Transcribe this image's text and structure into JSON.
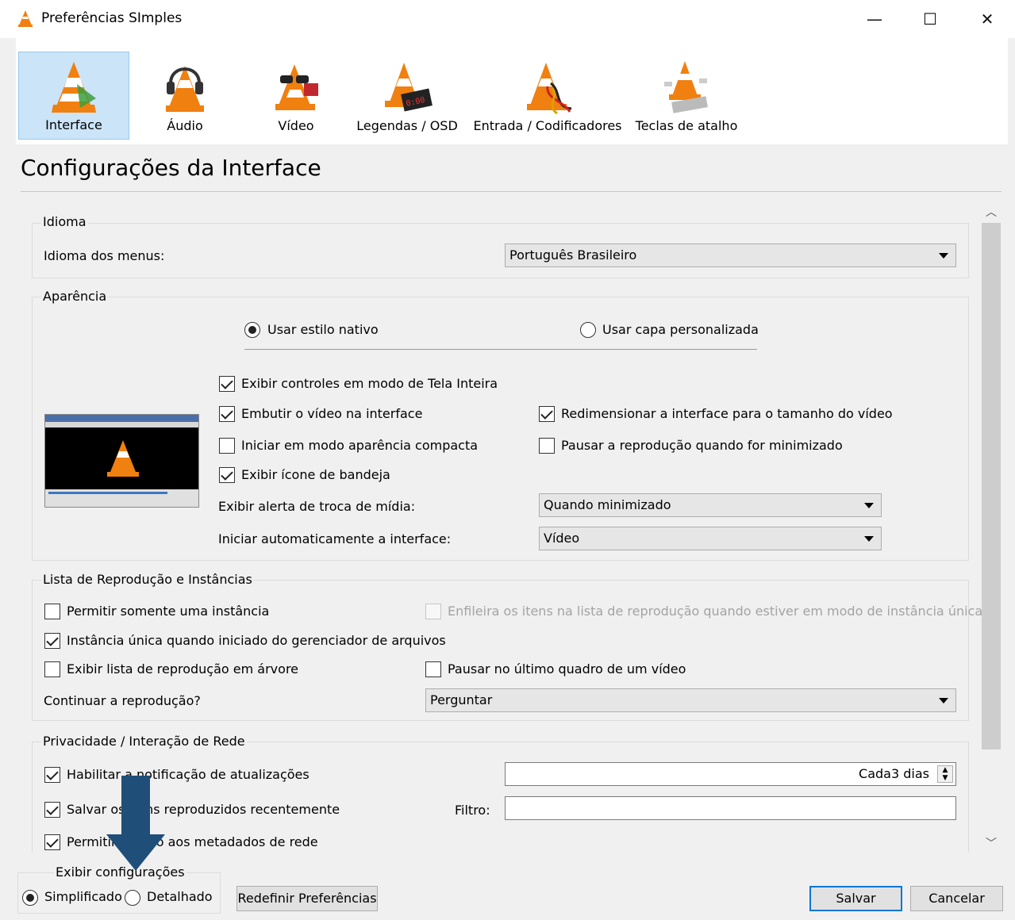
{
  "window": {
    "title": "Preferências SImples",
    "controls": {
      "minimize": "—",
      "maximize": "☐",
      "close": "✕"
    }
  },
  "toolbar": {
    "items": [
      {
        "label": "Interface",
        "icon": "vlc-cone-interface-icon",
        "selected": true
      },
      {
        "label": "Áudio",
        "icon": "vlc-cone-headphones-icon",
        "selected": false
      },
      {
        "label": "Vídeo",
        "icon": "vlc-cone-glasses-icon",
        "selected": false
      },
      {
        "label": "Legendas / OSD",
        "icon": "vlc-cone-clock-icon",
        "selected": false
      },
      {
        "label": "Entrada / Codificadores",
        "icon": "vlc-cone-cables-icon",
        "selected": false
      },
      {
        "label": "Teclas de atalho",
        "icon": "vlc-cone-keyboard-icon",
        "selected": false
      }
    ]
  },
  "page_title": "Configurações da Interface",
  "idioma": {
    "legend": "Idioma",
    "menu_lang_label": "Idioma dos menus:",
    "menu_lang_value": "Português Brasileiro"
  },
  "aparencia": {
    "legend": "Aparência",
    "native_style": "Usar estilo nativo",
    "custom_skin": "Usar capa personalizada",
    "fullscreen_controls": "Exibir controles em modo de Tela Inteira",
    "embed_video": "Embutir o vídeo na interface",
    "resize_interface": "Redimensionar a interface para o tamanho do vídeo",
    "compact_mode": "Iniciar em modo aparência compacta",
    "pause_minimized": "Pausar a reprodução quando for minimizado",
    "tray_icon": "Exibir ícone de bandeja",
    "media_alert_label": "Exibir alerta de troca de mídia:",
    "media_alert_value": "Quando minimizado",
    "autostart_label": "Iniciar automaticamente a interface:",
    "autostart_value": "Vídeo"
  },
  "playlist": {
    "legend": "Lista de Reprodução e Instâncias",
    "single_instance": "Permitir somente uma instância",
    "enqueue_items": "Enfileira os itens na lista de reprodução quando estiver em modo de instância única",
    "single_from_fm": "Instância única quando iniciado do gerenciador de arquivos",
    "tree_playlist": "Exibir lista de reprodução em árvore",
    "pause_last_frame": "Pausar no último quadro de um vídeo",
    "continue_label": "Continuar a reprodução?",
    "continue_value": "Perguntar"
  },
  "privacy": {
    "legend": "Privacidade / Interação de Rede",
    "updates": "Habilitar a notificação de atualizações",
    "updates_interval": "Cada3 dias",
    "recent": "Salvar os itens reproduzidos recentemente",
    "filter_label": "Filtro:",
    "filter_value": "",
    "metadata": "Permitir acesso aos metadados de rede"
  },
  "footer": {
    "legend": "Exibir configurações",
    "simple": "Simplificado",
    "detailed": "Detalhado",
    "reset": "Redefinir Preferências",
    "save": "Salvar",
    "cancel": "Cancelar"
  },
  "colors": {
    "selected_bg": "#cce4f7",
    "accent": "#0078d7",
    "arrow_annotation": "#1f4e79"
  }
}
